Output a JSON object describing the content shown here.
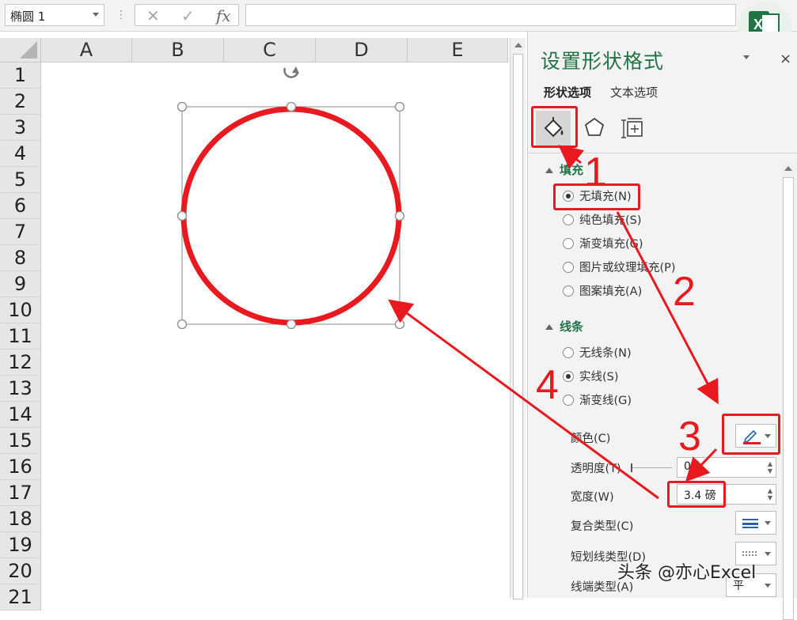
{
  "toolbar": {
    "name_box": "椭圆 1",
    "cancel": "✕",
    "enter": "✓",
    "fx": "fx",
    "formula": ""
  },
  "logo": {
    "excel_letter": "X",
    "caption": "亦心"
  },
  "columns": [
    "A",
    "B",
    "C",
    "D",
    "E"
  ],
  "rows": [
    "1",
    "2",
    "3",
    "4",
    "5",
    "6",
    "7",
    "8",
    "9",
    "10",
    "11",
    "12",
    "13",
    "14",
    "15",
    "16",
    "17",
    "18",
    "19",
    "20",
    "21"
  ],
  "shape": {
    "name": "椭圆 1",
    "outline_color": "#e8191f",
    "fill": "none"
  },
  "panel": {
    "title": "设置形状格式",
    "close": "×",
    "tabs": [
      "形状选项",
      "文本选项"
    ],
    "fill_section": {
      "title": "填充",
      "options": [
        {
          "label": "无填充(N)",
          "selected": true
        },
        {
          "label": "纯色填充(S)",
          "selected": false
        },
        {
          "label": "渐变填充(G)",
          "selected": false
        },
        {
          "label": "图片或纹理填充(P)",
          "selected": false
        },
        {
          "label": "图案填充(A)",
          "selected": false
        }
      ]
    },
    "line_section": {
      "title": "线条",
      "options": [
        {
          "label": "无线条(N)",
          "selected": false
        },
        {
          "label": "实线(S)",
          "selected": true
        },
        {
          "label": "渐变线(G)",
          "selected": false
        }
      ]
    },
    "props": {
      "color_label": "颜色(C)",
      "transparency_label": "透明度(T)",
      "transparency_value": "0%",
      "width_label": "宽度(W)",
      "width_value": "3.4 磅",
      "compound_label": "复合类型(C)",
      "dash_label": "短划线类型(D)",
      "cap_label": "线端类型(A)",
      "cap_value": "平"
    },
    "line_color": "#e8191f"
  },
  "annotations": [
    "1",
    "2",
    "3",
    "4"
  ],
  "watermark": "头条 @亦心Excel"
}
